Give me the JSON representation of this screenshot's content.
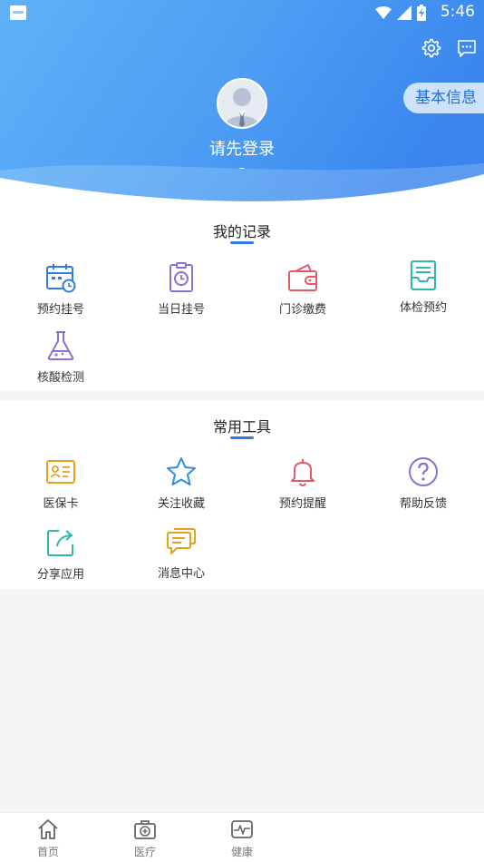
{
  "status_bar": {
    "time": "5:46"
  },
  "header": {
    "login_prompt": "请先登录",
    "login_sub": "–",
    "basic_info_button": "基本信息",
    "icons": {
      "settings": "gear-icon",
      "messages": "chat-icon",
      "avatar": "user-avatar-icon"
    }
  },
  "records": {
    "title": "我的记录",
    "items": [
      {
        "label": "预约挂号",
        "icon": "calendar-clock-icon",
        "color": "#2f7de1"
      },
      {
        "label": "当日挂号",
        "icon": "clipboard-clock-icon",
        "color": "#8a6fd6"
      },
      {
        "label": "门诊缴费",
        "icon": "wallet-icon",
        "color": "#e05a6a"
      },
      {
        "label": "体检预约",
        "icon": "tray-check-icon",
        "color": "#2fb7a8"
      },
      {
        "label": "核酸检测",
        "icon": "flask-icon",
        "color": "#8a6fd6"
      }
    ]
  },
  "tools": {
    "title": "常用工具",
    "items": [
      {
        "label": "医保卡",
        "icon": "id-card-icon",
        "color": "#e8a21a"
      },
      {
        "label": "关注收藏",
        "icon": "star-icon",
        "color": "#2f8fe1"
      },
      {
        "label": "预约提醒",
        "icon": "bell-icon",
        "color": "#e05a6a"
      },
      {
        "label": "帮助反馈",
        "icon": "help-circle-icon",
        "color": "#8a6fd6"
      },
      {
        "label": "分享应用",
        "icon": "share-icon",
        "color": "#2fb7a8"
      },
      {
        "label": "消息中心",
        "icon": "message-icon",
        "color": "#e8a21a"
      }
    ]
  },
  "bottom_nav": {
    "items": [
      {
        "label": "首页",
        "icon": "home-icon"
      },
      {
        "label": "医疗",
        "icon": "medical-kit-icon"
      },
      {
        "label": "健康",
        "icon": "heart-monitor-icon"
      }
    ]
  }
}
